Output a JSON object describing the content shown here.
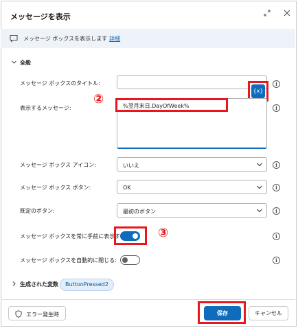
{
  "dialog": {
    "title": "メッセージを表示"
  },
  "info": {
    "text": "メッセージ ボックスを表示します",
    "link": "詳細"
  },
  "section_general": {
    "label": "全般"
  },
  "fields": {
    "title_label": "メッセージ ボックスのタイトル:",
    "title_value": "",
    "message_label": "表示するメッセージ:",
    "message_value": "%翌月末日.DayOfWeek%",
    "icon_label": "メッセージ ボックス アイコン:",
    "icon_value": "いいえ",
    "buttons_label": "メッセージ ボックス ボタン:",
    "buttons_value": "OK",
    "default_button_label": "既定のボタン:",
    "default_button_value": "最初のボタン",
    "always_on_top_label": "メッセージ ボックスを常に手前に表示する:",
    "always_on_top": true,
    "auto_close_label": "メッセージ ボックスを自動的に閉じる:",
    "auto_close": false
  },
  "variable_button": {
    "label": "{x}"
  },
  "annotations": {
    "marker_2": "②",
    "marker_3": "③"
  },
  "generated_vars": {
    "label": "生成された変数",
    "badge": "ButtonPressed2"
  },
  "footer": {
    "on_error": "エラー発生時",
    "save": "保存",
    "cancel": "キャンセル"
  },
  "colors": {
    "accent": "#0f6cbd",
    "highlight": "#e8171d"
  }
}
